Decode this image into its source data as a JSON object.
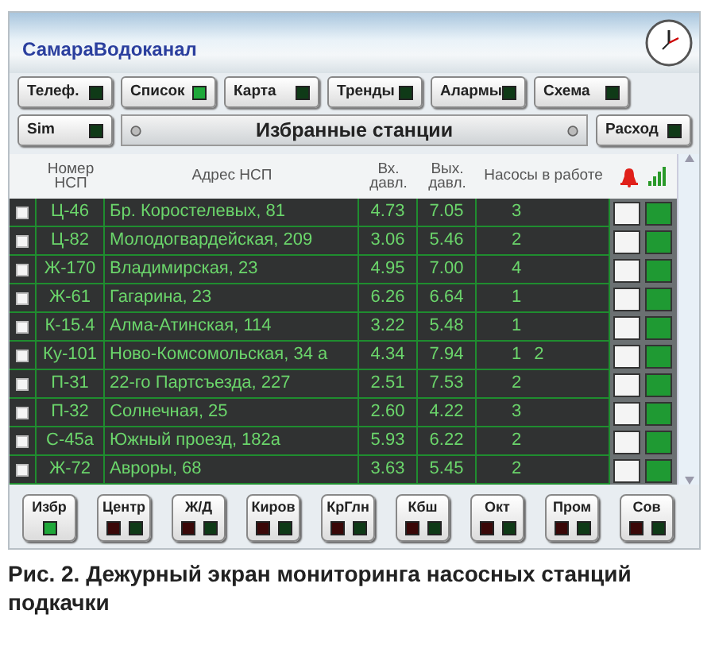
{
  "header": {
    "title": "СамараВодоканал"
  },
  "nav_buttons": [
    {
      "label": "Телеф.",
      "on": false
    },
    {
      "label": "Список",
      "on": true
    },
    {
      "label": "Карта",
      "on": false
    },
    {
      "label": "Тренды",
      "on": false
    },
    {
      "label": "Алармы",
      "on": false
    },
    {
      "label": "Схема",
      "on": false
    },
    {
      "label": "Sim",
      "on": false
    },
    {
      "label": "Расход",
      "on": false
    }
  ],
  "panel_title": "Избранные станции",
  "table": {
    "columns": [
      "Номер НСП",
      "Адрес НСП",
      "Вх. давл.",
      "Вых. давл.",
      "Насосы в работе"
    ],
    "rows": [
      {
        "checked": false,
        "number": "Ц-46",
        "address": "Бр. Коростелевых, 81",
        "inlet": "4.73",
        "outlet": "7.05",
        "pumps": [
          "3"
        ],
        "alarm": false,
        "online": true
      },
      {
        "checked": false,
        "number": "Ц-82",
        "address": "Молодогвардейская, 209",
        "inlet": "3.06",
        "outlet": "5.46",
        "pumps": [
          "2"
        ],
        "alarm": false,
        "online": true
      },
      {
        "checked": false,
        "number": "Ж-170",
        "address": "Владимирская, 23",
        "inlet": "4.95",
        "outlet": "7.00",
        "pumps": [
          "4"
        ],
        "alarm": false,
        "online": true
      },
      {
        "checked": false,
        "number": "Ж-61",
        "address": "Гагарина, 23",
        "inlet": "6.26",
        "outlet": "6.64",
        "pumps": [
          "1"
        ],
        "alarm": false,
        "online": true
      },
      {
        "checked": false,
        "number": "К-15.4",
        "address": "Алма-Атинская, 114",
        "inlet": "3.22",
        "outlet": "5.48",
        "pumps": [
          "1"
        ],
        "alarm": false,
        "online": true
      },
      {
        "checked": false,
        "number": "Ку-101",
        "address": "Ново-Комсомольская, 34 а",
        "inlet": "4.34",
        "outlet": "7.94",
        "pumps": [
          "1",
          "2"
        ],
        "alarm": false,
        "online": true
      },
      {
        "checked": false,
        "number": "П-31",
        "address": "22-го Партсъезда, 227",
        "inlet": "2.51",
        "outlet": "7.53",
        "pumps": [
          "2"
        ],
        "alarm": false,
        "online": true
      },
      {
        "checked": false,
        "number": "П-32",
        "address": "Солнечная, 25",
        "inlet": "2.60",
        "outlet": "4.22",
        "pumps": [
          "3"
        ],
        "alarm": false,
        "online": true
      },
      {
        "checked": false,
        "number": "С-45а",
        "address": "Южный проезд, 182а",
        "inlet": "5.93",
        "outlet": "6.22",
        "pumps": [
          "2"
        ],
        "alarm": false,
        "online": true
      },
      {
        "checked": false,
        "number": "Ж-72",
        "address": "Авроры, 68",
        "inlet": "3.63",
        "outlet": "5.45",
        "pumps": [
          "2"
        ],
        "alarm": false,
        "online": true
      }
    ]
  },
  "district_buttons": [
    {
      "label": "Избр",
      "indicators": [
        {
          "kind": "status",
          "on": true
        }
      ]
    },
    {
      "label": "Центр",
      "indicators": [
        {
          "kind": "alarm",
          "on": false
        },
        {
          "kind": "status",
          "on": false
        }
      ]
    },
    {
      "label": "Ж/Д",
      "indicators": [
        {
          "kind": "alarm",
          "on": false
        },
        {
          "kind": "status",
          "on": false
        }
      ]
    },
    {
      "label": "Киров",
      "indicators": [
        {
          "kind": "alarm",
          "on": false
        },
        {
          "kind": "status",
          "on": false
        }
      ]
    },
    {
      "label": "КрГлн",
      "indicators": [
        {
          "kind": "alarm",
          "on": false
        },
        {
          "kind": "status",
          "on": false
        }
      ]
    },
    {
      "label": "Кбш",
      "indicators": [
        {
          "kind": "alarm",
          "on": false
        },
        {
          "kind": "status",
          "on": false
        }
      ]
    },
    {
      "label": "Окт",
      "indicators": [
        {
          "kind": "alarm",
          "on": false
        },
        {
          "kind": "status",
          "on": false
        }
      ]
    },
    {
      "label": "Пром",
      "indicators": [
        {
          "kind": "alarm",
          "on": false
        },
        {
          "kind": "status",
          "on": false
        }
      ]
    },
    {
      "label": "Сов",
      "indicators": [
        {
          "kind": "alarm",
          "on": false
        },
        {
          "kind": "status",
          "on": false
        }
      ]
    }
  ],
  "caption": "Рис. 2. Дежурный экран мониторинга насосных станций подкачки"
}
